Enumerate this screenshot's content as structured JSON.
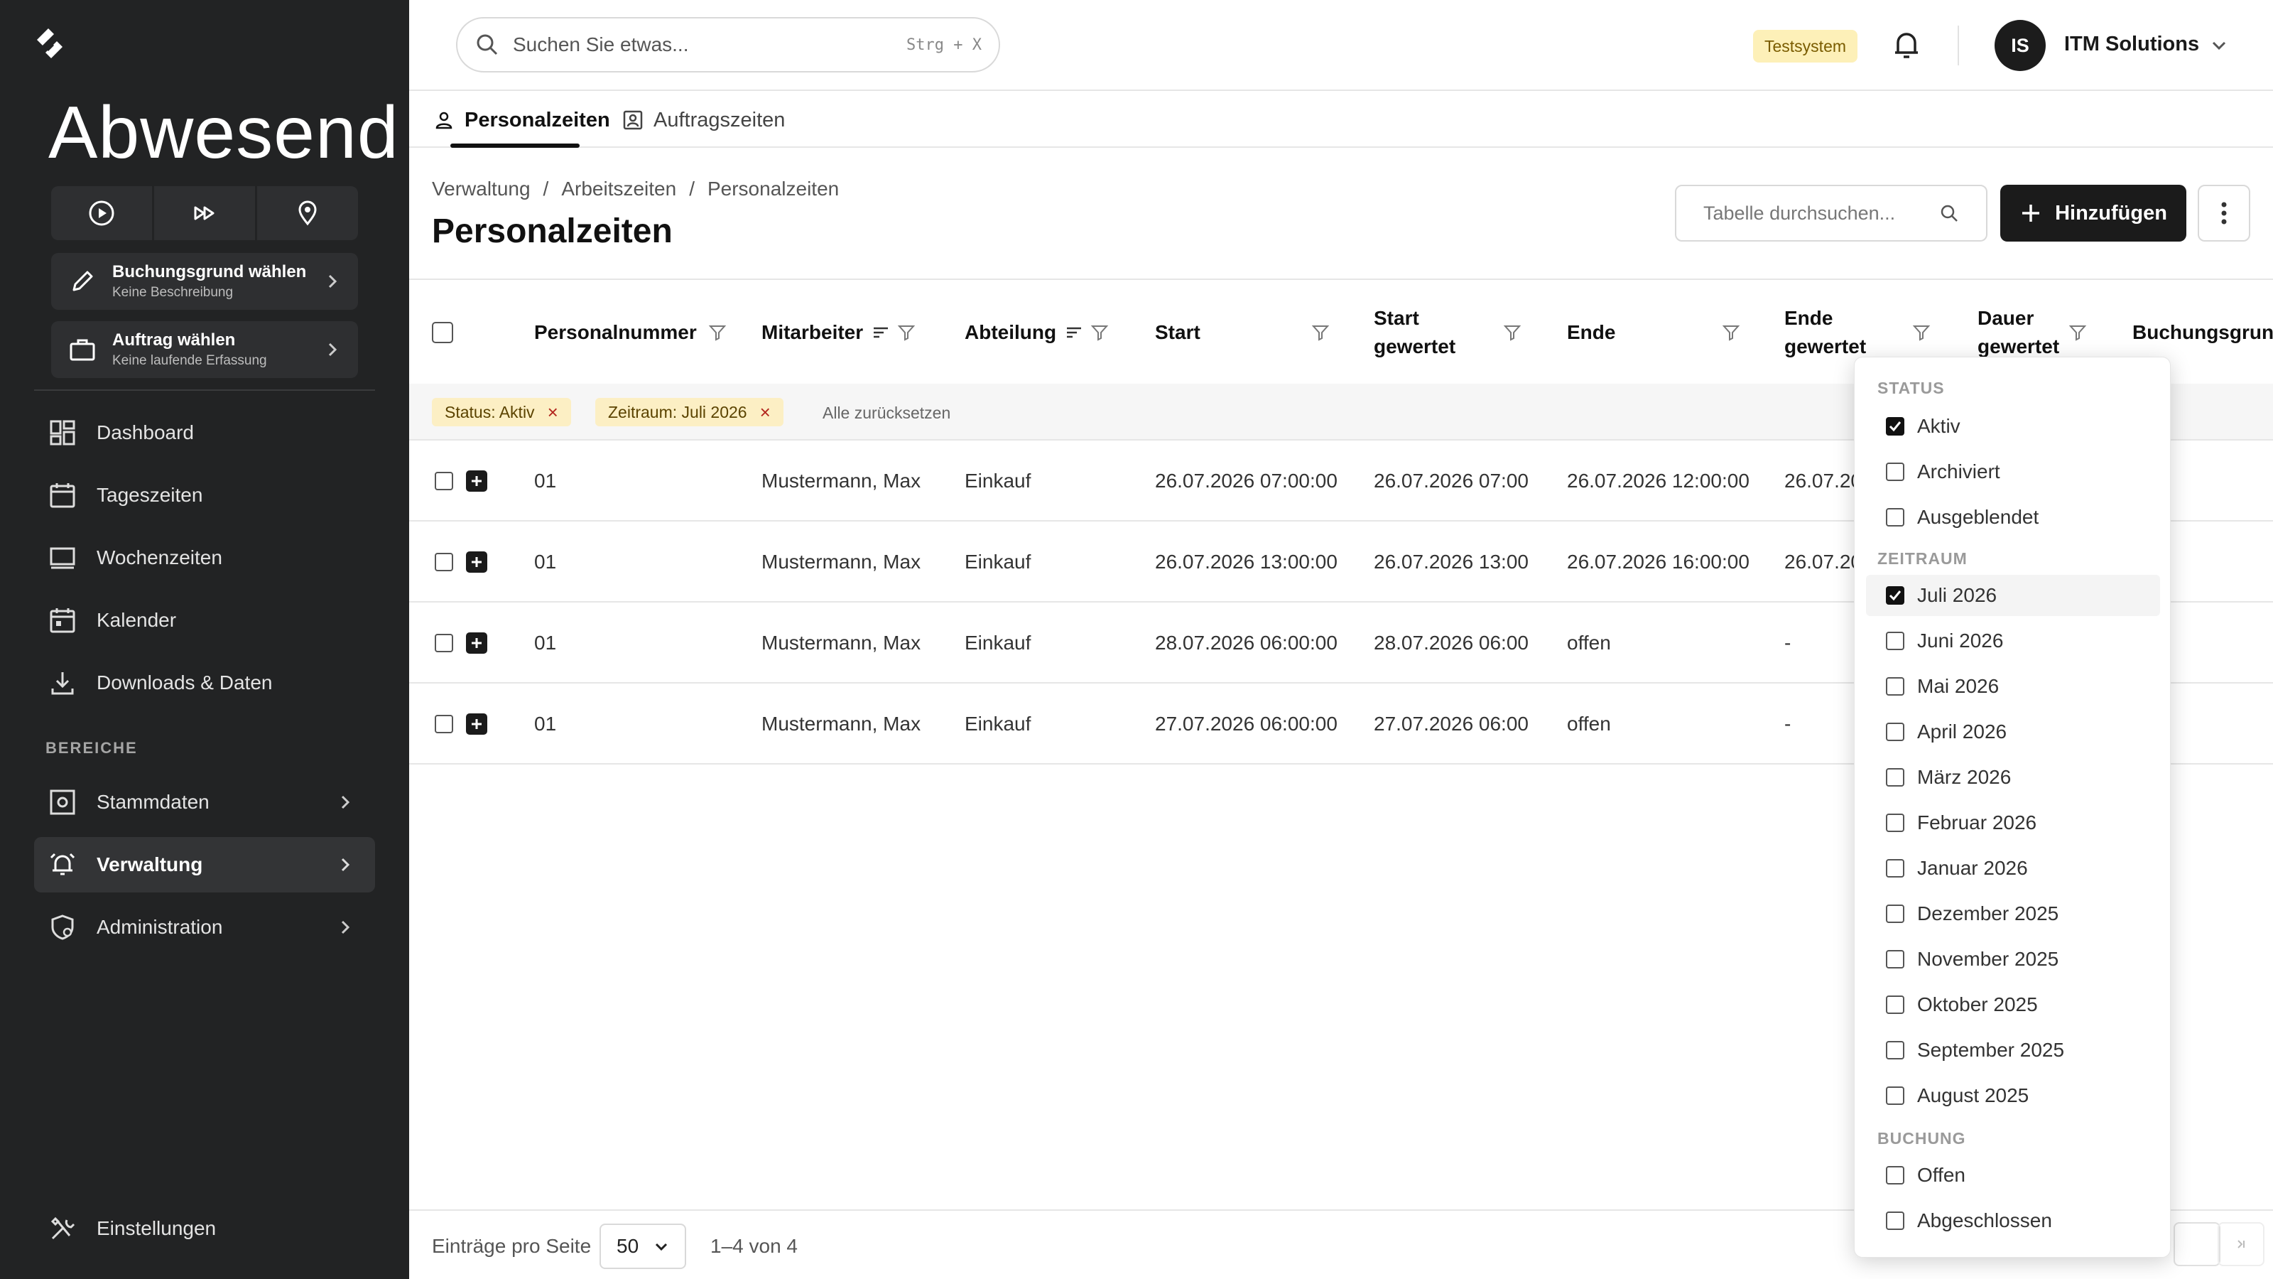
{
  "sidebar": {
    "status": "Abwesend",
    "picks": [
      {
        "title": "Buchungsgrund wählen",
        "subtitle": "Keine Beschreibung"
      },
      {
        "title": "Auftrag wählen",
        "subtitle": "Keine laufende Erfassung"
      }
    ],
    "nav": [
      {
        "label": "Dashboard",
        "icon": "dashboard-icon"
      },
      {
        "label": "Tageszeiten",
        "icon": "calendar-icon"
      },
      {
        "label": "Wochenzeiten",
        "icon": "monitor-icon"
      },
      {
        "label": "Kalender",
        "icon": "calendar-event-icon"
      },
      {
        "label": "Downloads & Daten",
        "icon": "download-icon"
      }
    ],
    "section_label": "BEREICHE",
    "sections": [
      {
        "label": "Stammdaten",
        "icon": "settings-square-icon"
      },
      {
        "label": "Verwaltung",
        "icon": "bell-alarm-icon"
      },
      {
        "label": "Administration",
        "icon": "shield-user-icon"
      }
    ],
    "settings_label": "Einstellungen"
  },
  "topbar": {
    "search_placeholder": "Suchen Sie etwas...",
    "shortcut": "Strg + X",
    "env_badge": "Testsystem",
    "avatar_initials": "IS",
    "company": "ITM Solutions"
  },
  "tabs": [
    {
      "label": "Personalzeiten",
      "active": true
    },
    {
      "label": "Auftragszeiten",
      "active": false
    }
  ],
  "breadcrumb": [
    "Verwaltung",
    "Arbeitszeiten",
    "Personalzeiten"
  ],
  "page_title": "Personalzeiten",
  "table_search_placeholder": "Tabelle durchsuchen...",
  "add_label": "Hinzufügen",
  "columns": [
    "Personalnummer",
    "Mitarbeiter",
    "Abteilung",
    "Start",
    "Start gewertet",
    "Ende",
    "Ende gewertet",
    "Dauer gewertet",
    "Buchungsgrund"
  ],
  "chips": [
    "Status: Aktiv",
    "Zeitraum: Juli 2026"
  ],
  "reset_label": "Alle zurücksetzen",
  "rows": [
    {
      "nr": "01",
      "name": "Mustermann, Max",
      "dept": "Einkauf",
      "start": "26.07.2026 07:00:00",
      "start_w": "26.07.2026 07:00",
      "end": "26.07.2026 12:00:00",
      "end_w": "26.07.20"
    },
    {
      "nr": "01",
      "name": "Mustermann, Max",
      "dept": "Einkauf",
      "start": "26.07.2026 13:00:00",
      "start_w": "26.07.2026 13:00",
      "end": "26.07.2026 16:00:00",
      "end_w": "26.07.20"
    },
    {
      "nr": "01",
      "name": "Mustermann, Max",
      "dept": "Einkauf",
      "start": "28.07.2026 06:00:00",
      "start_w": "28.07.2026 06:00",
      "end": "offen",
      "end_w": "-"
    },
    {
      "nr": "01",
      "name": "Mustermann, Max",
      "dept": "Einkauf",
      "start": "27.07.2026 06:00:00",
      "start_w": "27.07.2026 06:00",
      "end": "offen",
      "end_w": "-"
    }
  ],
  "footer": {
    "per_page_label": "Einträge pro Seite",
    "per_page": "50",
    "range": "1–4 von 4"
  },
  "filter_menu": {
    "status_header": "STATUS",
    "status": [
      {
        "label": "Aktiv",
        "checked": true
      },
      {
        "label": "Archiviert",
        "checked": false
      },
      {
        "label": "Ausgeblendet",
        "checked": false
      }
    ],
    "period_header": "ZEITRAUM",
    "period": [
      {
        "label": "Juli 2026",
        "checked": true
      },
      {
        "label": "Juni 2026",
        "checked": false
      },
      {
        "label": "Mai 2026",
        "checked": false
      },
      {
        "label": "April 2026",
        "checked": false
      },
      {
        "label": "März 2026",
        "checked": false
      },
      {
        "label": "Februar 2026",
        "checked": false
      },
      {
        "label": "Januar 2026",
        "checked": false
      },
      {
        "label": "Dezember 2025",
        "checked": false
      },
      {
        "label": "November 2025",
        "checked": false
      },
      {
        "label": "Oktober 2025",
        "checked": false
      },
      {
        "label": "September 2025",
        "checked": false
      },
      {
        "label": "August 2025",
        "checked": false
      }
    ],
    "booking_header": "BUCHUNG",
    "booking": [
      {
        "label": "Offen",
        "checked": false
      },
      {
        "label": "Abgeschlossen",
        "checked": false
      }
    ]
  },
  "colors": {
    "sidebar_bg": "#222324",
    "accent": "#1b1b1b",
    "badge_bg": "#fdf0b8",
    "chip_bg": "#fcefc4"
  }
}
